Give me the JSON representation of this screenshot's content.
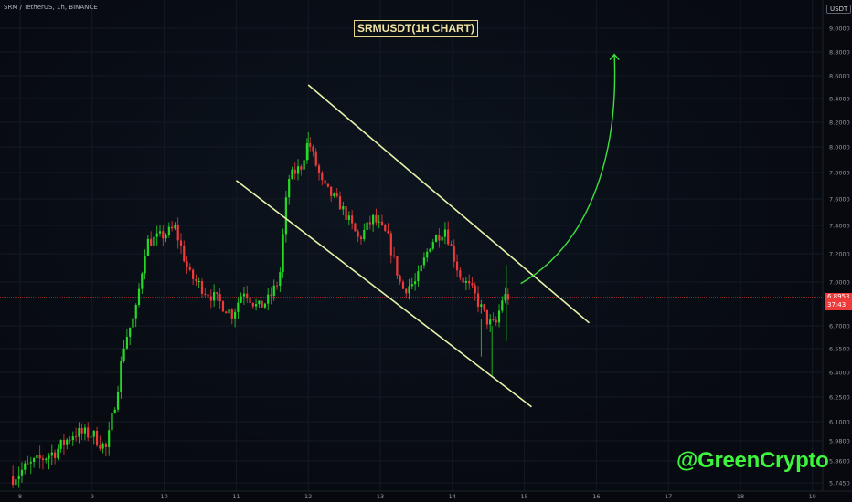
{
  "header": {
    "symbol": "SRM / TetherUS, 1h, BINANCE",
    "title": "SRMUSDT(1H CHART)",
    "currency": "USDT"
  },
  "watermark": "@GreenCrypto",
  "price_badge": {
    "price": "6.8953",
    "countdown": "37:43"
  },
  "colors": {
    "up": "#26d926",
    "down": "#ef3a3a",
    "channel": "#e8f2a8",
    "projection_arrow": "#3ee03e",
    "price_line": "#ef3a3a",
    "grid": "#141a24"
  },
  "chart_data": {
    "type": "candlestick",
    "title": "SRMUSDT(1H CHART)",
    "xlabel": "",
    "ylabel": "",
    "x_ticks": [
      "8",
      "9",
      "10",
      "11",
      "12",
      "13",
      "14",
      "15",
      "16",
      "17",
      "18",
      "19"
    ],
    "y_ticks": [
      "9.0000",
      "8.8000",
      "8.6000",
      "8.4000",
      "8.2000",
      "8.0000",
      "7.8000",
      "7.6000",
      "7.4000",
      "7.2000",
      "7.0000",
      "6.7000",
      "6.5500",
      "6.4000",
      "6.2500",
      "6.1000",
      "5.9800",
      "5.8600",
      "5.7450"
    ],
    "ylim": [
      5.72,
      9.08
    ],
    "xlim": [
      7.9,
      19.1
    ],
    "current_price": 6.8953,
    "waypoints": [
      {
        "x": 7.9,
        "y": 5.78
      },
      {
        "x": 8.2,
        "y": 5.85
      },
      {
        "x": 8.5,
        "y": 5.92
      },
      {
        "x": 8.75,
        "y": 6.03
      },
      {
        "x": 9.0,
        "y": 6.02
      },
      {
        "x": 9.2,
        "y": 5.93
      },
      {
        "x": 9.35,
        "y": 6.3
      },
      {
        "x": 9.45,
        "y": 6.6
      },
      {
        "x": 9.6,
        "y": 6.78
      },
      {
        "x": 9.75,
        "y": 7.28
      },
      {
        "x": 9.95,
        "y": 7.32
      },
      {
        "x": 10.15,
        "y": 7.38
      },
      {
        "x": 10.35,
        "y": 7.05
      },
      {
        "x": 10.55,
        "y": 6.95
      },
      {
        "x": 10.75,
        "y": 6.87
      },
      {
        "x": 10.95,
        "y": 6.78
      },
      {
        "x": 11.1,
        "y": 6.95
      },
      {
        "x": 11.3,
        "y": 6.82
      },
      {
        "x": 11.45,
        "y": 6.88
      },
      {
        "x": 11.6,
        "y": 7.02
      },
      {
        "x": 11.72,
        "y": 7.75
      },
      {
        "x": 11.9,
        "y": 7.85
      },
      {
        "x": 12.0,
        "y": 8.05
      },
      {
        "x": 12.2,
        "y": 7.7
      },
      {
        "x": 12.45,
        "y": 7.55
      },
      {
        "x": 12.7,
        "y": 7.3
      },
      {
        "x": 12.9,
        "y": 7.45
      },
      {
        "x": 13.1,
        "y": 7.32
      },
      {
        "x": 13.3,
        "y": 6.95
      },
      {
        "x": 13.5,
        "y": 7.0
      },
      {
        "x": 13.7,
        "y": 7.28
      },
      {
        "x": 13.9,
        "y": 7.38
      },
      {
        "x": 14.1,
        "y": 7.05
      },
      {
        "x": 14.3,
        "y": 6.92
      },
      {
        "x": 14.5,
        "y": 6.72
      },
      {
        "x": 14.6,
        "y": 6.7
      },
      {
        "x": 14.7,
        "y": 6.9
      },
      {
        "x": 14.8,
        "y": 6.9
      }
    ],
    "channel": {
      "upper": [
        {
          "x": 12.0,
          "y": 8.52
        },
        {
          "x": 15.9,
          "y": 6.72
        }
      ],
      "lower": [
        {
          "x": 11.0,
          "y": 7.74
        },
        {
          "x": 15.1,
          "y": 6.19
        }
      ]
    },
    "projection": {
      "start": {
        "x": 14.95,
        "y": 6.99
      },
      "end": {
        "x": 16.25,
        "y": 8.78
      }
    }
  }
}
